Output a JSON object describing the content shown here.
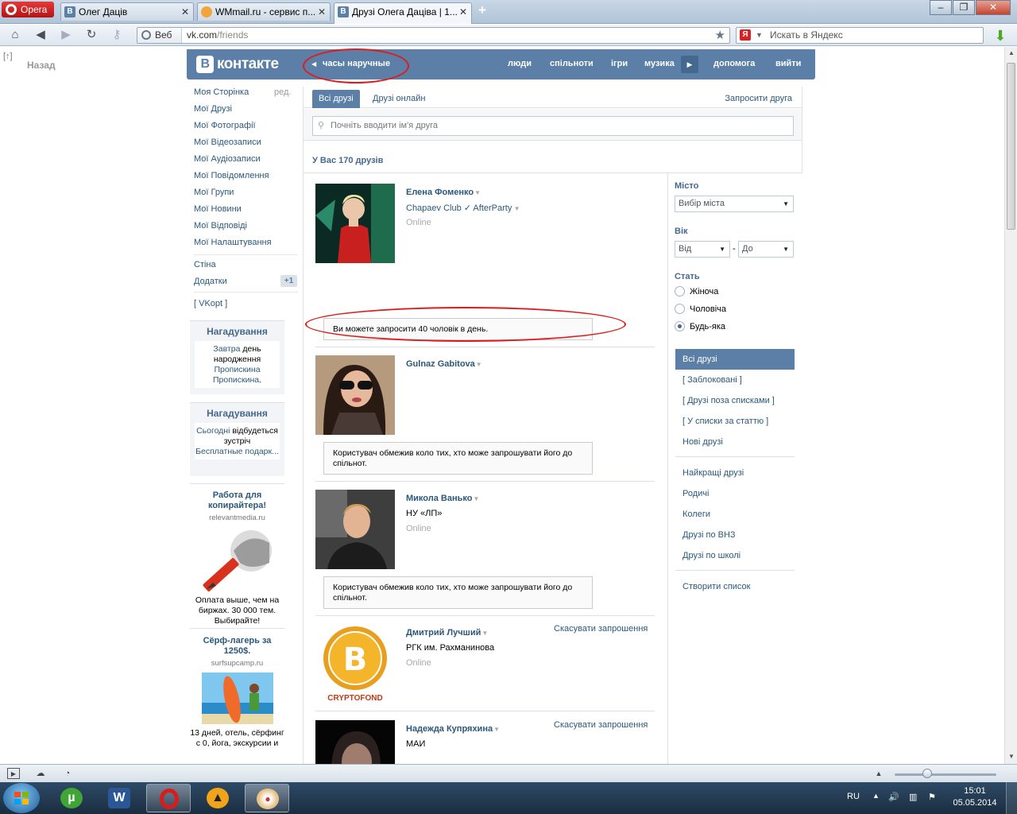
{
  "browser": {
    "menu_label": "Opera",
    "tabs": [
      {
        "title": "Олег Дацiв",
        "favicon": "vk-icon"
      },
      {
        "title": "WMmail.ru - сервис п...",
        "favicon": "wmmail-icon"
      },
      {
        "title": "Друзi Олега Дацiва | 1...",
        "favicon": "vk-icon"
      }
    ],
    "address_label": "Веб",
    "url_host": "vk.com",
    "url_path": "/friends",
    "search_placeholder": "Искать в Яндекс",
    "search_engine_letter": "Я"
  },
  "page": {
    "back_label": "Назад",
    "back_marker": "[↑]",
    "header": {
      "logo_letter": "В",
      "logo_text": "контакте",
      "status_text": "часы наручные",
      "nav": [
        "люди",
        "спiльноти",
        "iгри",
        "музика",
        "допомога",
        "вийти"
      ]
    },
    "left_menu": {
      "items": [
        "Моя Сторiнка",
        "Мої Друзi",
        "Мої Фотографiї",
        "Мої Вiдеозаписи",
        "Мої Аудiозаписи",
        "Мої Повiдомлення",
        "Мої Групи",
        "Мої Новини",
        "Мої Вiдповiдi",
        "Мої Налаштування"
      ],
      "edit_label": "ред.",
      "extra": [
        "Стiна",
        "Додатки"
      ],
      "apps_badge": "+1",
      "vkopt": "[ VKopt ]"
    },
    "reminders": [
      {
        "title": "Нагадування",
        "link1": "Завтра",
        "text1": " день народження",
        "link2": "Пропискина Пропискина",
        "text2": "."
      },
      {
        "title": "Нагадування",
        "link1": "Сьогоднi",
        "text1": " вiдбудеться зустрiч",
        "link2": "Бесплатные подарк...",
        "text2": ""
      }
    ],
    "ads": [
      {
        "title": "Работа для копирайтера!",
        "domain": "relevantmedia.ru",
        "text": "Оплата выше, чем на биржах. 30 000 тем. Выбирайте!",
        "image_icon": "pencil-hand-icon"
      },
      {
        "title": "Сёрф-лагерь за 1250$.",
        "domain": "surfsupcamp.ru",
        "text": "13 дней, отель, сёрфинг с 0, йога, экскурсии и",
        "image_icon": "surfboard-photo"
      }
    ],
    "friends_tabs": {
      "all": "Всi друзi",
      "online": "Друзi онлайн",
      "invite": "Запросити друга"
    },
    "friend_search_placeholder": "Почнiть вводити iм'я друга",
    "friends_count": "У Вас 170 друзiв",
    "friends": [
      {
        "name": "Елена Фоменко",
        "subtitle": "Chapaev Club ✓ AfterParty",
        "subtitle_is_link": true,
        "online": "Online",
        "notice": "Ви можете запросити 40 чоловiк в день.",
        "cancel": ""
      },
      {
        "name": "Gulnaz Gabitova",
        "subtitle": "",
        "subtitle_is_link": false,
        "online": "",
        "notice": "Користувач обмежив коло тих, хто може запрошувати його до спiльнот.",
        "cancel": ""
      },
      {
        "name": "Микола Ванько",
        "subtitle": "НУ «ЛП»",
        "subtitle_is_link": false,
        "online": "Online",
        "notice": "Користувач обмежив коло тих, хто може запрошувати його до спiльнот.",
        "cancel": ""
      },
      {
        "name": "Дмитрий Лучший",
        "subtitle": "РГК им. Рахманинова",
        "subtitle_is_link": false,
        "online": "Online",
        "notice": "",
        "cancel": "Скасувати запрошення",
        "avatar_text": "CRYPTOFOND"
      },
      {
        "name": "Надежда Купряхина",
        "subtitle": "МАИ",
        "subtitle_is_link": false,
        "online": "",
        "notice": "",
        "cancel": "Скасувати запрошення"
      }
    ],
    "filters": {
      "city_label": "Мiсто",
      "city_value": "Вибiр мiста",
      "age_label": "Вiк",
      "age_from": "Вiд",
      "age_dash": "-",
      "age_to": "До",
      "gender_label": "Стать",
      "genders": [
        "Жiноча",
        "Чоловiча",
        "Будь-яка"
      ],
      "gender_selected": 2,
      "lists_top": [
        "Всi друзi",
        "[ Заблокованi ]",
        "[ Друзi поза списками ]",
        "[ У списки за статтю ]",
        "Новi друзi"
      ],
      "lists_bottom": [
        "Найкращi друзi",
        "Родичi",
        "Колеги",
        "Друзi по ВНЗ",
        "Друзi по школi"
      ],
      "create": "Створити список"
    }
  },
  "taskbar": {
    "apps": [
      "windows-start",
      "utorrent-icon",
      "word-icon",
      "opera-icon",
      "daemon-tools-icon",
      "paint-icon"
    ],
    "lang": "RU",
    "time": "15:01",
    "date": "05.05.2014"
  },
  "colors": {
    "vk_blue": "#5b7fa6",
    "vk_link": "#2b587a",
    "annotation_red": "#e01b1b"
  }
}
